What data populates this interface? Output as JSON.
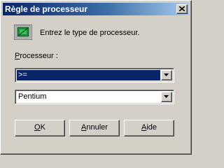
{
  "window": {
    "title": "Règle de processeur",
    "close_glyph": "close-icon"
  },
  "info": {
    "icon": "processor-icon",
    "text": "Entrez le type de processeur."
  },
  "processor_label": {
    "mnemonic": "P",
    "rest": "rocesseur :"
  },
  "operator_combo": {
    "value": ">="
  },
  "processor_combo": {
    "value": "Pentium"
  },
  "buttons": {
    "ok": {
      "mnemonic": "O",
      "rest": "K"
    },
    "cancel": {
      "mnemonic": "A",
      "rest": "nnuler"
    },
    "help": {
      "mnemonic": "A",
      "rest": "ide"
    }
  },
  "colors": {
    "face": "#d4d0c8",
    "title_start": "#0a246a",
    "title_end": "#a6caf0",
    "selection": "#0a246a"
  }
}
